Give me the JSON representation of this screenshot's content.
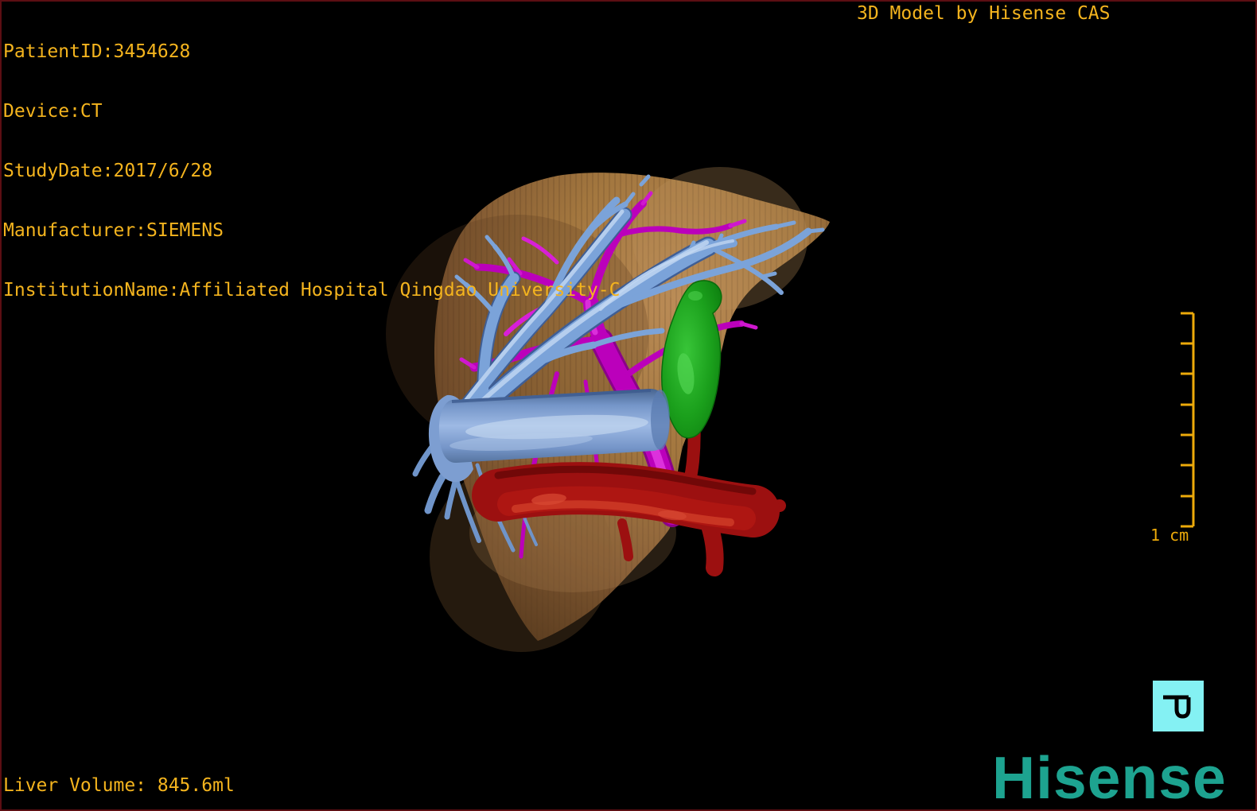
{
  "overlay": {
    "patient_lines": [
      "PatientID:3454628",
      "Device:CT",
      "StudyDate:2017/6/28",
      "Manufacturer:SIEMENS",
      "InstitutionName:Affiliated Hospital Qingdao University-C"
    ],
    "watermark": "3D Model by Hisense CAS",
    "liver_volume": "Liver Volume: 845.6ml",
    "scale_label": "1 cm",
    "brand": "Hisense"
  },
  "colors": {
    "annotation_text": "#f4b41e",
    "scale_bar": "#edaa0a",
    "brand_teal": "#1da390",
    "orientation_icon_bg": "#84f1f3",
    "frame_border": "#5c0e13",
    "background": "#000000"
  },
  "model": {
    "structures": [
      {
        "name": "liver",
        "color": "#a87a48"
      },
      {
        "name": "hepatic-veins",
        "color": "#7ba3d9"
      },
      {
        "name": "portal-vein",
        "color": "#bb00bb"
      },
      {
        "name": "gallbladder",
        "color": "#1ba01c"
      },
      {
        "name": "hepatic-artery",
        "color": "#9c1010"
      },
      {
        "name": "inferior-vena-cava",
        "color": "#9cbbe6"
      }
    ]
  }
}
